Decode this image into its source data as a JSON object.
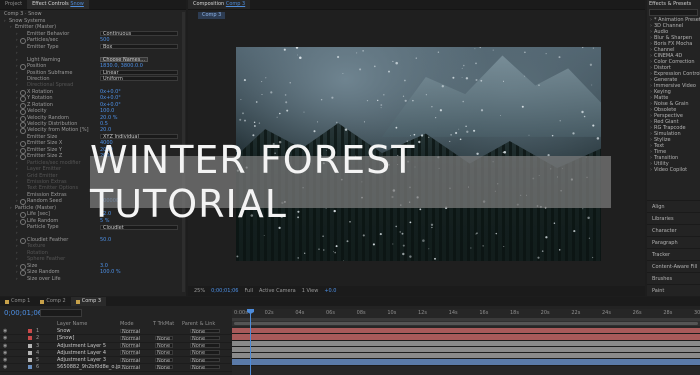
{
  "effect_controls": {
    "tabs": [
      "Project",
      "Effect Controls",
      "Snow"
    ],
    "subtitle": "Comp 3 · Snow",
    "rows": [
      {
        "label": "Snow Systems",
        "value": "",
        "indent": 0,
        "kind": "text"
      },
      {
        "label": "Emitter (Master)",
        "value": "",
        "indent": 1,
        "kind": "text"
      },
      {
        "label": "Emitter Behavior",
        "value": "Continuous",
        "indent": 2,
        "kind": "box"
      },
      {
        "label": "Particles/sec",
        "value": "500",
        "indent": 2,
        "kind": "num"
      },
      {
        "label": "Emitter Type",
        "value": "Box",
        "indent": 2,
        "kind": "box"
      },
      {
        "label": "",
        "value": "",
        "indent": 2,
        "kind": "text"
      },
      {
        "label": "Light Naming",
        "value": "Choose Names...",
        "indent": 2,
        "kind": "btn"
      },
      {
        "label": "Position",
        "value": "1830.0, 3800.0.0",
        "indent": 2,
        "kind": "num"
      },
      {
        "label": "Position Subframe",
        "value": "Linear",
        "indent": 2,
        "kind": "box"
      },
      {
        "label": "Direction",
        "value": "Uniform",
        "indent": 2,
        "kind": "box"
      },
      {
        "label": "Directional Spread",
        "value": "",
        "indent": 2,
        "kind": "dim"
      },
      {
        "label": "X Rotation",
        "value": "0x+0.0°",
        "indent": 2,
        "kind": "num"
      },
      {
        "label": "Y Rotation",
        "value": "0x+0.0°",
        "indent": 2,
        "kind": "num"
      },
      {
        "label": "Z Rotation",
        "value": "0x+0.0°",
        "indent": 2,
        "kind": "num"
      },
      {
        "label": "Velocity",
        "value": "100.0",
        "indent": 2,
        "kind": "num"
      },
      {
        "label": "Velocity Random",
        "value": "20.0 %",
        "indent": 2,
        "kind": "num"
      },
      {
        "label": "Velocity Distribution",
        "value": "0.5",
        "indent": 2,
        "kind": "num"
      },
      {
        "label": "Velocity from Motion [%]",
        "value": "20.0",
        "indent": 2,
        "kind": "num"
      },
      {
        "label": "Emitter Size",
        "value": "XYZ Individual",
        "indent": 2,
        "kind": "box"
      },
      {
        "label": "Emitter Size X",
        "value": "4000",
        "indent": 2,
        "kind": "num"
      },
      {
        "label": "Emitter Size Y",
        "value": "2000",
        "indent": 2,
        "kind": "num"
      },
      {
        "label": "Emitter Size Z",
        "value": "2000",
        "indent": 2,
        "kind": "num"
      },
      {
        "label": "Particles/sec modifier",
        "value": "",
        "indent": 2,
        "kind": "dim"
      },
      {
        "label": "Layer Emitter",
        "value": "",
        "indent": 2,
        "kind": "dim"
      },
      {
        "label": "Grid Emitter",
        "value": "",
        "indent": 2,
        "kind": "dim"
      },
      {
        "label": "Emission Extras",
        "value": "",
        "indent": 2,
        "kind": "dim"
      },
      {
        "label": "Text Emitter Options",
        "value": "",
        "indent": 2,
        "kind": "dim"
      },
      {
        "label": "Emission Extras",
        "value": "",
        "indent": 2,
        "kind": "text"
      },
      {
        "label": "Random Seed",
        "value": "100000",
        "indent": 2,
        "kind": "num"
      },
      {
        "label": "Particle (Master)",
        "value": "",
        "indent": 1,
        "kind": "text"
      },
      {
        "label": "Life [sec]",
        "value": "12.0",
        "indent": 2,
        "kind": "num"
      },
      {
        "label": "Life Random",
        "value": "5 %",
        "indent": 2,
        "kind": "num"
      },
      {
        "label": "Particle Type",
        "value": "Cloudlet",
        "indent": 2,
        "kind": "box"
      },
      {
        "label": "",
        "value": "",
        "indent": 2,
        "kind": "text"
      },
      {
        "label": "Cloudlet Feather",
        "value": "50.0",
        "indent": 2,
        "kind": "num"
      },
      {
        "label": "Texture",
        "value": "",
        "indent": 2,
        "kind": "dim"
      },
      {
        "label": "Rotation",
        "value": "",
        "indent": 2,
        "kind": "dim"
      },
      {
        "label": "Sphere Feather",
        "value": "",
        "indent": 2,
        "kind": "dim"
      },
      {
        "label": "Size",
        "value": "3.0",
        "indent": 2,
        "kind": "num"
      },
      {
        "label": "Size Random",
        "value": "100.0 %",
        "indent": 2,
        "kind": "num"
      },
      {
        "label": "Size over Life",
        "value": "",
        "indent": 2,
        "kind": "text"
      }
    ]
  },
  "composition": {
    "tabs": [
      "Composition",
      "Comp 3"
    ],
    "subtab": "Comp 3",
    "bottom": [
      "25%",
      "0;00;01;06",
      "Full",
      "Active Camera",
      "1 View",
      "+0.0"
    ]
  },
  "effects_presets": {
    "title": "Effects & Presets",
    "items": [
      "* Animation Presets",
      "3D Channel",
      "Audio",
      "Blur & Sharpen",
      "Boris FX Mocha",
      "Channel",
      "CINEMA 4D",
      "Color Correction",
      "Distort",
      "Expression Controls",
      "Generate",
      "Immersive Video",
      "Keying",
      "Matte",
      "Noise & Grain",
      "Obsolete",
      "Perspective",
      "Red Giant",
      "RG Trapcode",
      "Simulation",
      "Stylize",
      "Text",
      "Time",
      "Transition",
      "Utility",
      "Video Copilot"
    ],
    "sections": [
      "Align",
      "Libraries",
      "Character",
      "Paragraph",
      "Tracker",
      "Content-Aware Fill",
      "Brushes",
      "Paint"
    ]
  },
  "overlay_title": "WINTER FOREST TUTORIAL",
  "timeline": {
    "tabs": [
      "Comp 1",
      "Comp 2",
      "Comp 3"
    ],
    "timecode": "0;00;01;06",
    "columns": [
      "Layer Name",
      "Mode",
      "T TrkMat",
      "Parent & Link"
    ],
    "layers": [
      {
        "num": "1",
        "name": "Snow",
        "mode": "Normal",
        "trk": "",
        "parent": "None",
        "color": "#c84a4a"
      },
      {
        "num": "2",
        "name": "[Snow]",
        "mode": "Normal",
        "trk": "None",
        "parent": "None",
        "color": "#c84a4a"
      },
      {
        "num": "3",
        "name": "Adjustment Layer 5",
        "mode": "Normal",
        "trk": "None",
        "parent": "None",
        "color": "#b5b5b5"
      },
      {
        "num": "4",
        "name": "Adjustment Layer 4",
        "mode": "Normal",
        "trk": "None",
        "parent": "None",
        "color": "#b5b5b5"
      },
      {
        "num": "5",
        "name": "Adjustment Layer 3",
        "mode": "Normal",
        "trk": "None",
        "parent": "None",
        "color": "#b5b5b5"
      },
      {
        "num": "6",
        "name": "5650882_9h2bf0d8e_o.jpg",
        "mode": "Normal",
        "trk": "None",
        "parent": "None",
        "color": "#6a8fbf"
      }
    ],
    "ruler": [
      "0:00s",
      "02s",
      "04s",
      "06s",
      "08s",
      "10s",
      "12s",
      "14s",
      "16s",
      "18s",
      "20s",
      "22s",
      "24s",
      "26s",
      "28s",
      "30s"
    ],
    "bar_colors": [
      "#a85a5a",
      "#a85a5a",
      "#8a8a8a",
      "#8a8a8a",
      "#8a8a8a",
      "#5a7aa8"
    ]
  },
  "colors": {
    "accent": "#4d90e6",
    "bg": "#232323"
  }
}
